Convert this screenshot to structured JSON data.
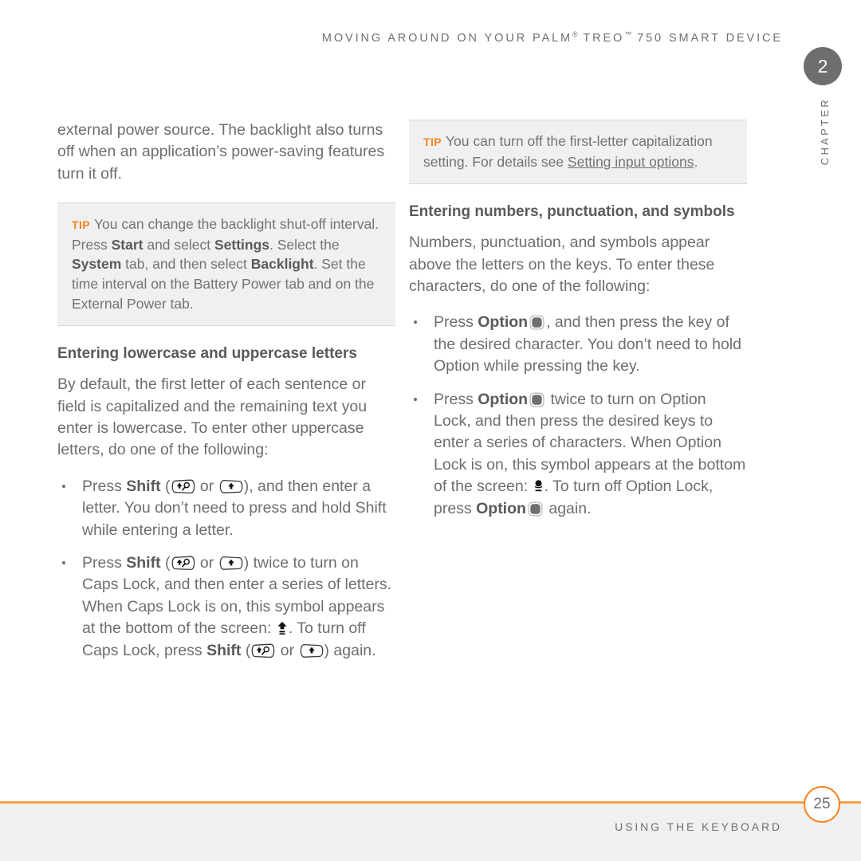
{
  "header": {
    "title_prefix": "MOVING AROUND ON YOUR PALM",
    "reg_mark": "®",
    "title_mid": " TREO",
    "tm_mark": "™",
    "title_suffix": " 750 SMART DEVICE",
    "chapter_number": "2",
    "chapter_label": "CHAPTER"
  },
  "colors": {
    "accent_orange": "#F5821F",
    "footer_rule": "#F5A14A",
    "text_gray": "#6E6E6E",
    "heading_gray": "#5A5A5A",
    "tip_background": "#F0F0F0"
  },
  "left_column": {
    "intro_paragraph": "external power source. The backlight also turns off when an application’s power-saving features turn it off.",
    "tip": {
      "label": "TIP",
      "part1": "You can change the backlight shut-off interval. Press ",
      "bold1": "Start",
      "part2": " and select ",
      "bold2": "Settings",
      "part3": ". Select the ",
      "bold3": "System",
      "part4": " tab, and then select ",
      "bold4": "Backlight",
      "part5": ". Set the time interval on the Battery Power tab and on the External Power tab."
    },
    "heading": "Entering lowercase and uppercase letters",
    "paragraph": "By default, the first letter of each sentence or field is capitalized and the remaining text you enter is lowercase. To enter other uppercase letters, do one of the following:",
    "bullets": [
      {
        "before_keyword": "Press ",
        "keyword": "Shift",
        "paren_open": " (",
        "or_text": " or ",
        "paren_close": ")",
        "after": ", and then enter a letter. You don’t need to press and hold Shift while entering a letter."
      },
      {
        "before_keyword": "Press ",
        "keyword": "Shift",
        "paren_open": " (",
        "or_text": " or ",
        "paren_close": ")",
        "after_part1": " twice to turn on Caps Lock, and then enter a series of letters. When Caps Lock is on, this symbol appears at the bottom of the screen: ",
        "after_part2": ". To turn off Caps Lock, press ",
        "keyword2": "Shift",
        "after_part3": " again."
      }
    ]
  },
  "right_column": {
    "tip": {
      "label": "TIP",
      "part1": "You can turn off the first-letter capitalization setting. For details see ",
      "link": "Setting input options",
      "part2": "."
    },
    "heading": "Entering numbers, punctuation, and symbols",
    "paragraph": "Numbers, punctuation, and symbols appear above the letters on the keys. To enter these characters, do one of the following:",
    "bullets": [
      {
        "before_keyword": "Press ",
        "keyword": "Option",
        "after": ", and then press the key of the desired character. You don’t need to hold Option while pressing the key."
      },
      {
        "before_keyword": "Press ",
        "keyword": "Option",
        "after_part1": " twice to turn on Option Lock, and then press the desired keys to enter a series of characters. When Option Lock is on, this symbol appears at the bottom of the screen: ",
        "after_part2": ". To turn off Option Lock, press ",
        "keyword2": "Option",
        "after_part3": " again."
      }
    ]
  },
  "footer": {
    "title": "USING THE KEYBOARD",
    "page_number": "25"
  },
  "icons": {
    "shift_left": "shift-key-magnifier-icon",
    "shift_right": "shift-key-arrow-icon",
    "option_key": "option-key-icon",
    "caps_lock_symbol": "caps-lock-arrow-symbol",
    "option_lock_symbol": "option-lock-symbol"
  }
}
